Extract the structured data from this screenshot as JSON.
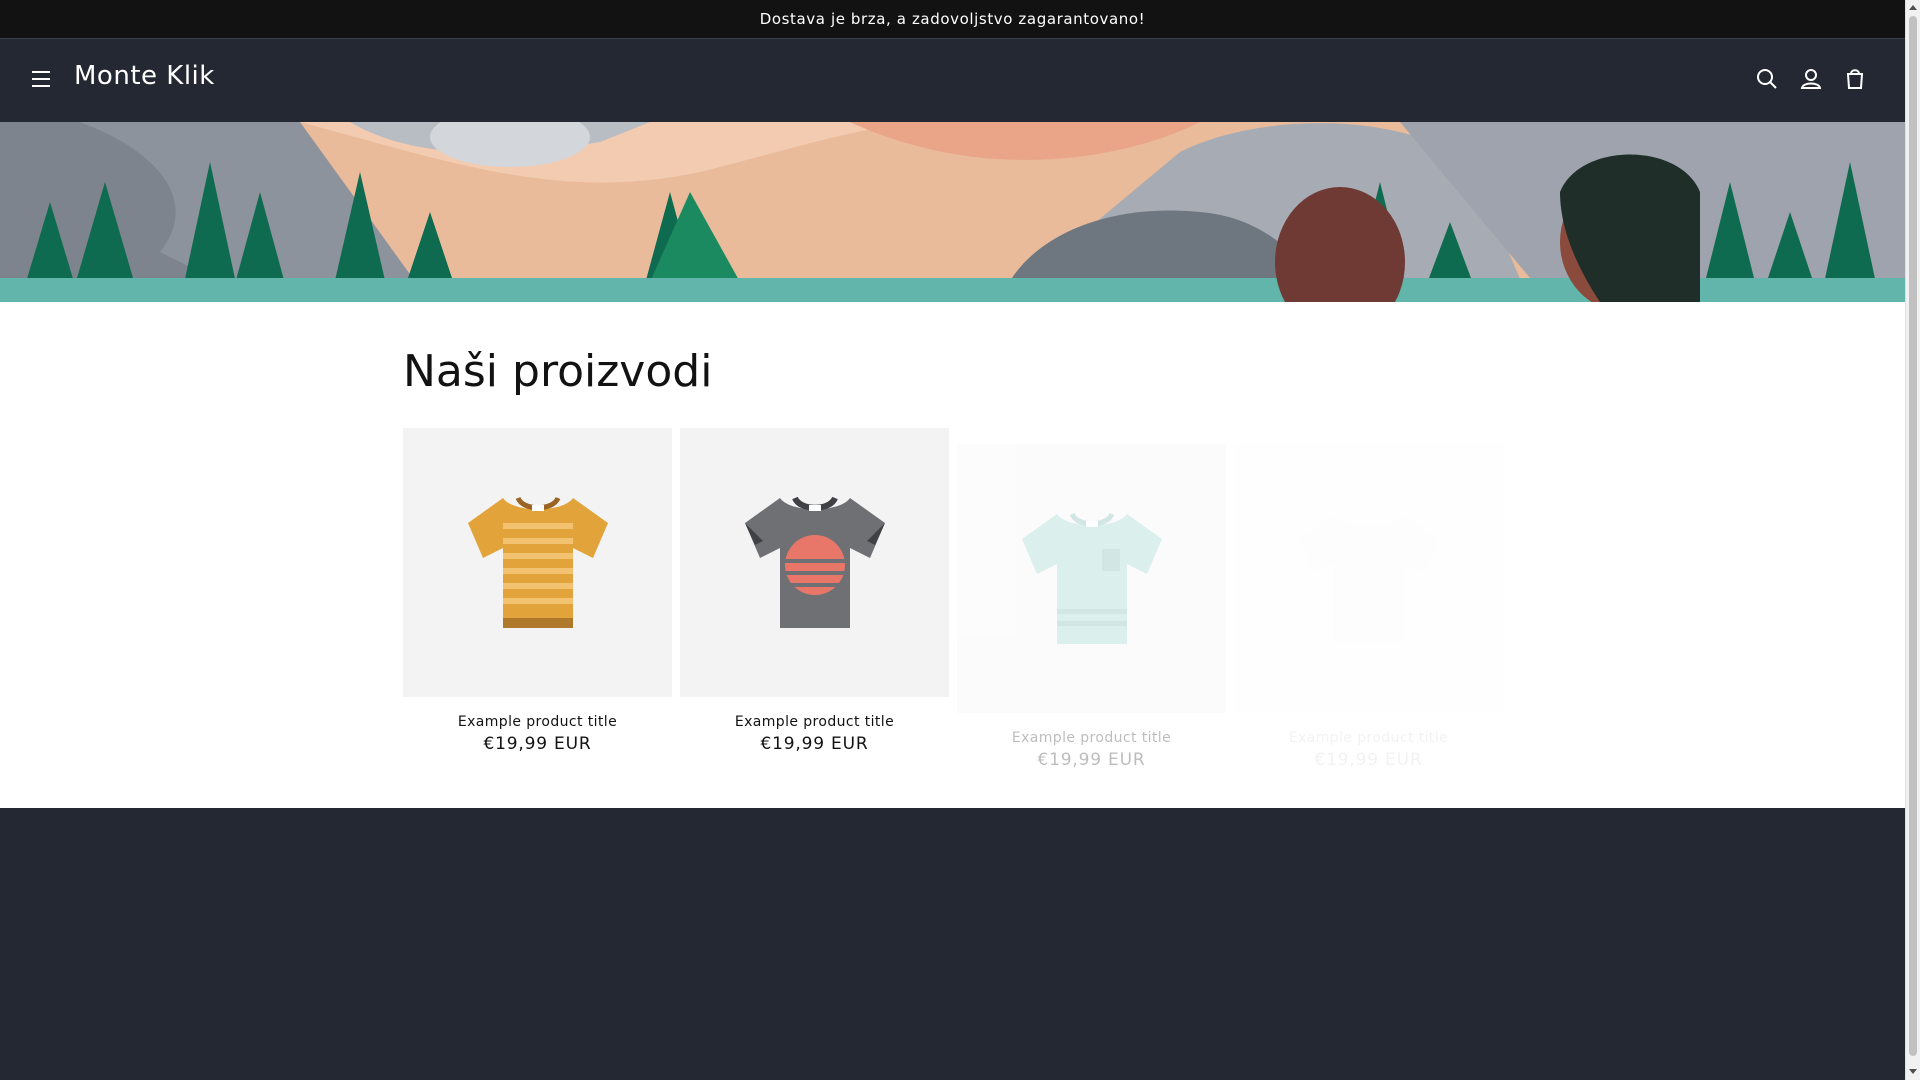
{
  "announcement": {
    "text": "Dostava je brza, a zadovoljstvo zagarantovano!"
  },
  "header": {
    "brand": "Monte Klik",
    "icons": [
      "menu-icon",
      "search-icon",
      "account-icon",
      "cart-icon"
    ]
  },
  "colors": {
    "header_bg": "#242833",
    "announcement_bg": "#121212",
    "card_bg": "#f3f3f3",
    "footer_bg": "#242833"
  },
  "collection": {
    "title": "Naši proizvodi",
    "products": [
      {
        "title": "Example product title",
        "price": "€19,99 EUR",
        "variant": "orange-striped-tshirt"
      },
      {
        "title": "Example product title",
        "price": "€19,99 EUR",
        "variant": "gray-sunset-tshirt"
      },
      {
        "title": "Example product title",
        "price": "€19,99 EUR",
        "variant": "mint-pocket-tshirt"
      },
      {
        "title": "Example product title",
        "price": "€19,99 EUR",
        "variant": "white-tshirt"
      }
    ]
  }
}
